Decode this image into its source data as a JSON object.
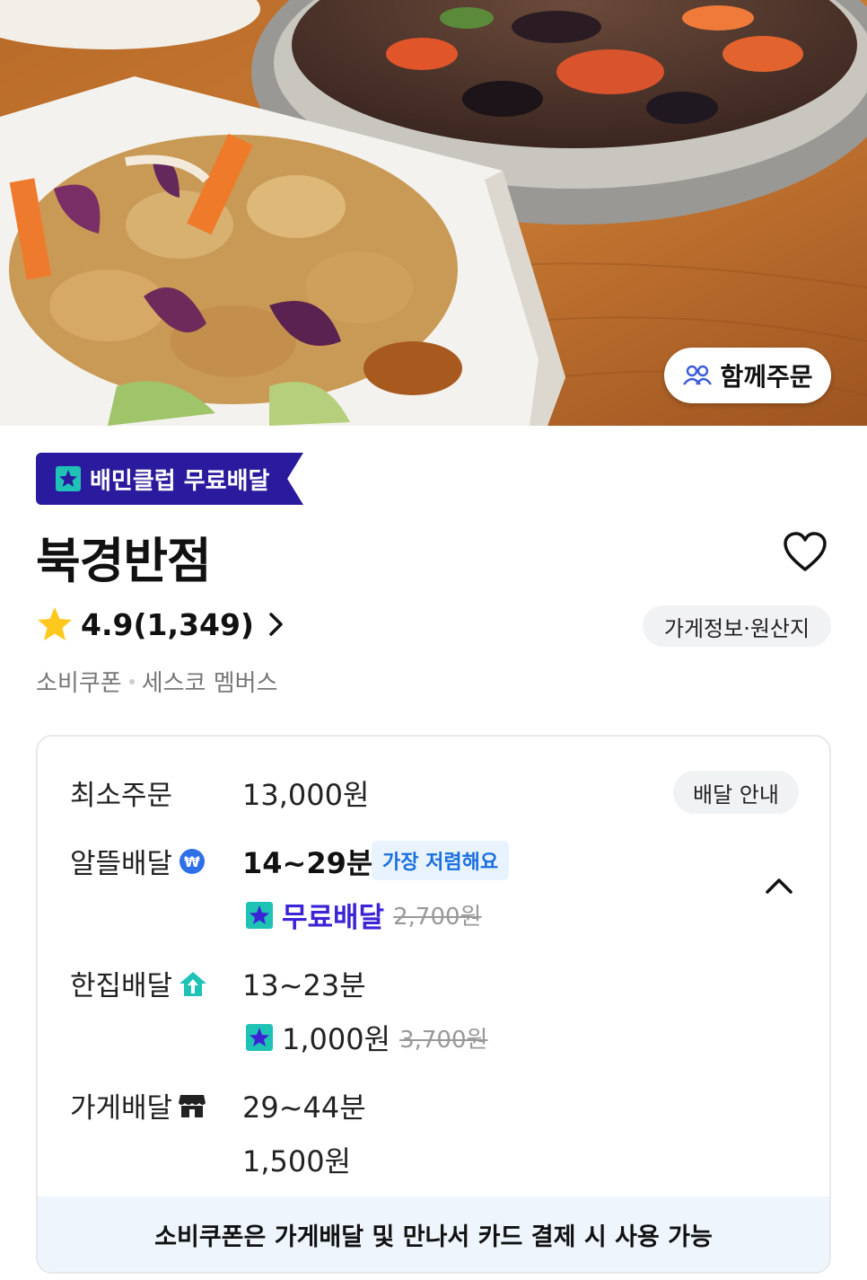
{
  "hero": {
    "group_order_label": "함께주문"
  },
  "store": {
    "club_badge": "배민클럽 무료배달",
    "name": "북경반점",
    "rating": "4.9(1,349)",
    "info_pill": "가게정보·원산지",
    "tags": [
      "소비쿠폰",
      "세스코 멤버스"
    ]
  },
  "delivery": {
    "min_order_label": "최소주문",
    "min_order_value": "13,000원",
    "guide_button": "배달 안내",
    "economy": {
      "label": "알뜰배달",
      "time": "14~29분",
      "badge": "가장 저렴해요",
      "fee": "무료배달",
      "original_fee": "2,700원"
    },
    "single": {
      "label": "한집배달",
      "time": "13~23분",
      "fee": "1,000원",
      "original_fee": "3,700원"
    },
    "store_delivery": {
      "label": "가게배달",
      "time": "29~44분",
      "fee": "1,500원"
    },
    "footer_note": "소비쿠폰은 가게배달 및 만나서 카드 결제 시 사용 가능"
  },
  "colors": {
    "club_purple": "#2a1a9e",
    "mint": "#1fc3b6",
    "blue_accent": "#1a6fe0",
    "free_delivery": "#3b24d6"
  },
  "icons": [
    "users-icon",
    "club-star-icon",
    "heart-icon",
    "star-icon",
    "chevron-right-icon",
    "coin-icon",
    "home-arrow-icon",
    "store-icon",
    "chevron-up-icon"
  ]
}
